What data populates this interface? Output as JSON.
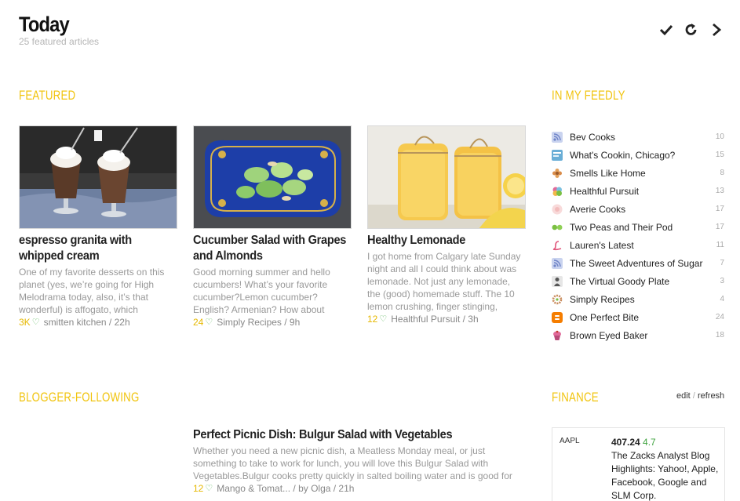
{
  "header": {
    "title": "Today",
    "subtitle": "25 featured articles"
  },
  "sections": {
    "featured": "FEATURED",
    "in_my_feedly": "IN MY FEEDLY",
    "blogger_following": "BLOGGER-FOLLOWING",
    "finance": "FINANCE"
  },
  "featured": [
    {
      "title": "espresso granita with whipped cream",
      "snippet": "One of my favorite desserts on this planet (yes, we’re going for High Melodrama today, also, it’s that wonderful) is affogato, which",
      "count": "3K",
      "source": "smitten kitchen / 22h"
    },
    {
      "title": "Cucumber Salad with Grapes and Almonds",
      "snippet": "Good morning summer and hello cucumbers! What’s your favorite cucumber?Lemon cucumber? English? Armenian? How about",
      "count": "24",
      "source": "Simply Recipes / 9h"
    },
    {
      "title": "Healthy Lemonade",
      "snippet": "I got home from Calgary late Sunday night and all I could think about was lemonade. Not just any lemonade, the (good) homemade stuff. The 10 lemon crushing, finger stinging,",
      "count": "12",
      "source": "Healthful Pursuit / 3h"
    }
  ],
  "feedly": [
    {
      "name": "Bev Cooks",
      "count": "10",
      "icon": "rss-icon",
      "color": "#8c9fd6"
    },
    {
      "name": "What's Cookin, Chicago?",
      "count": "15",
      "icon": "blog-icon",
      "color": "#5aa0c8"
    },
    {
      "name": "Smells Like Home",
      "count": "8",
      "icon": "flower-icon",
      "color": "#d98c4a"
    },
    {
      "name": "Healthful Pursuit",
      "count": "13",
      "icon": "blossom-icon",
      "color": "#e06a9a"
    },
    {
      "name": "Averie Cooks",
      "count": "17",
      "icon": "circle-icon",
      "color": "#f2c9c9"
    },
    {
      "name": "Two Peas and Their Pod",
      "count": "17",
      "icon": "peas-icon",
      "color": "#7bc043"
    },
    {
      "name": "Lauren's Latest",
      "count": "11",
      "icon": "script-l-icon",
      "color": "#e0557a"
    },
    {
      "name": "The Sweet Adventures of Sugar",
      "count": "7",
      "icon": "rss-icon",
      "color": "#8c9fd6"
    },
    {
      "name": "The Virtual Goody Plate",
      "count": "3",
      "icon": "figure-icon",
      "color": "#666666"
    },
    {
      "name": "Simply Recipes",
      "count": "4",
      "icon": "wreath-icon",
      "color": "#c88a5a"
    },
    {
      "name": "One Perfect Bite",
      "count": "24",
      "icon": "blogger-icon",
      "color": "#f57d00"
    },
    {
      "name": "Brown Eyed Baker",
      "count": "18",
      "icon": "cupcake-icon",
      "color": "#d8588a"
    }
  ],
  "finance": {
    "edit": "edit",
    "separator": "/",
    "refresh": "refresh",
    "ticker": "AAPL",
    "price": "407.24",
    "change": "4.7",
    "headline": "The Zacks Analyst Blog Highlights: Yahoo!, Apple, Facebook, Google and SLM Corp."
  },
  "blogger_post": {
    "title": "Perfect Picnic Dish: Bulgur Salad with Vegetables",
    "snippet": "Whether you need a new picnic dish, a Meatless Monday meal, or just something to take to work for lunch, you will love this Bulgur Salad with Vegetables.Bulgur cooks pretty quickly in salted boiling water and is good for",
    "count": "12",
    "source": "Mango & Tomat... / by Olga / 21h"
  },
  "colors": {
    "accent": "#f1c40f",
    "heart": "#5cb85c",
    "count": "#e6b800",
    "positive": "#3fa33f"
  }
}
